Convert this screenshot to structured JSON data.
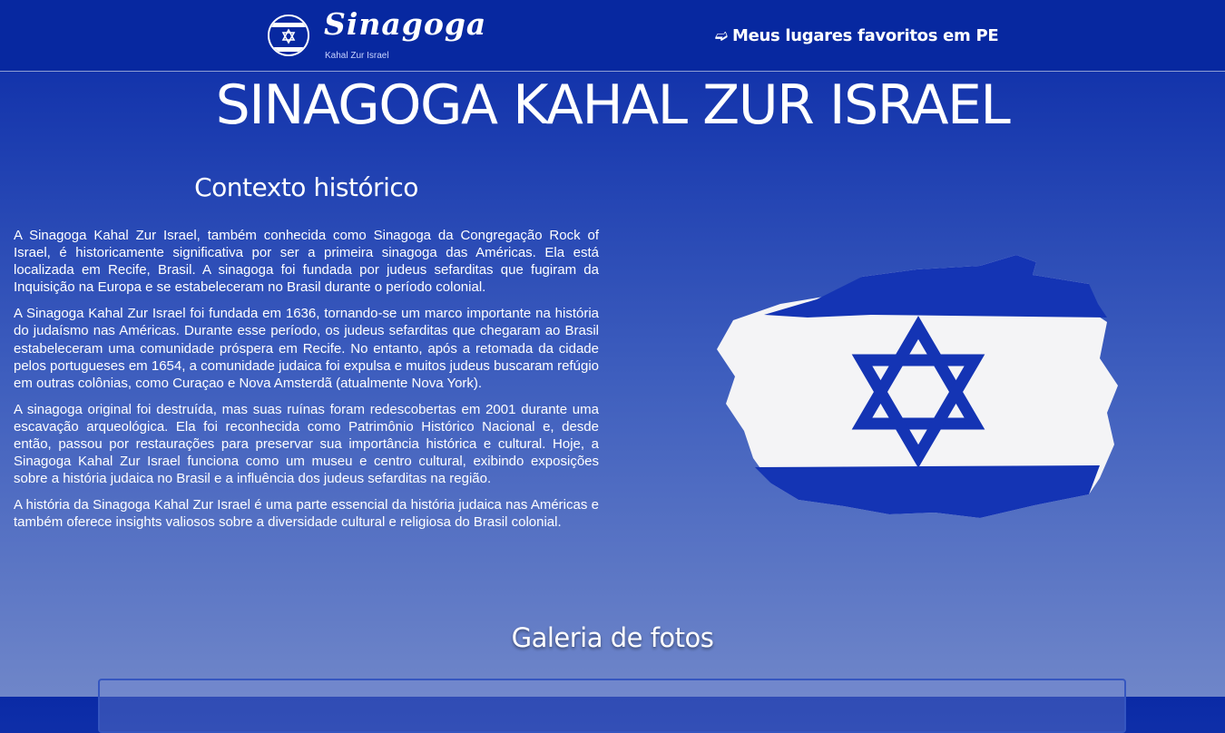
{
  "header": {
    "logo": {
      "title": "Sinagoga",
      "subtitle": "Kahal Zur Israel",
      "icon": "star-of-david-icon"
    },
    "nav_link": {
      "icon": "arrow-right-icon",
      "label": "Meus lugares favoritos em PE"
    }
  },
  "page": {
    "title": "SINAGOGA KAHAL ZUR ISRAEL"
  },
  "history": {
    "heading": "Contexto histórico",
    "paragraphs": [
      "A Sinagoga Kahal Zur Israel, também conhecida como Sinagoga da Congregação Rock of Israel, é historicamente significativa por ser a primeira sinagoga das Américas. Ela está localizada em Recife, Brasil. A sinagoga foi fundada por judeus sefarditas que fugiram da Inquisição na Europa e se estabeleceram no Brasil durante o período colonial.",
      "A Sinagoga Kahal Zur Israel foi fundada em 1636, tornando-se um marco importante na história do judaísmo nas Américas. Durante esse período, os judeus sefarditas que chegaram ao Brasil estabeleceram uma comunidade próspera em Recife. No entanto, após a retomada da cidade pelos portugueses em 1654, a comunidade judaica foi expulsa e muitos judeus buscaram refúgio em outras colônias, como Curaçao e Nova Amsterdã (atualmente Nova York).",
      "A sinagoga original foi destruída, mas suas ruínas foram redescobertas em 2001 durante uma escavação arqueológica. Ela foi reconhecida como Patrimônio Histórico Nacional e, desde então, passou por restaurações para preservar sua importância histórica e cultural. Hoje, a Sinagoga Kahal Zur Israel funciona como um museu e centro cultural, exibindo exposições sobre a história judaica no Brasil e a influência dos judeus sefarditas na região.",
      "A história da Sinagoga Kahal Zur Israel é uma parte essencial da história judaica nas Américas e também oferece insights valiosos sobre a diversidade cultural e religiosa do Brasil colonial."
    ]
  },
  "flag_image": {
    "icon": "israel-flag-image",
    "colors": {
      "blue": "#1434b4",
      "white": "#f4f4f6"
    }
  },
  "gallery": {
    "heading": "Galeria de fotos"
  },
  "theme": {
    "header_bg": "#0728a0",
    "gradient_top": "#0a2aa6",
    "gradient_bottom": "#6f86c9",
    "text": "#ffffff"
  }
}
